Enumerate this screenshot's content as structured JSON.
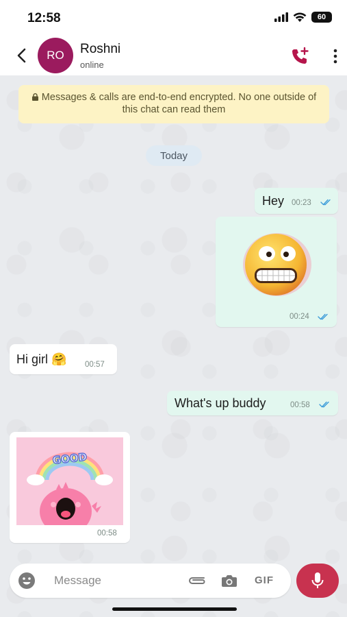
{
  "status_bar": {
    "time": "12:58",
    "battery": "60"
  },
  "header": {
    "avatar_initials": "RO",
    "contact_name": "Roshni",
    "contact_status": "online",
    "avatar_color": "#9b1b5e",
    "accent_color": "#b5154b"
  },
  "encryption_notice": "Messages & calls are end-to-end encrypted. No one outside of this chat can read them",
  "date_chip": "Today",
  "messages": [
    {
      "direction": "out",
      "type": "text",
      "text": "Hey",
      "time": "00:23",
      "status": "read"
    },
    {
      "direction": "out",
      "type": "sticker",
      "sticker": "grimacing-face-emoji",
      "time": "00:24",
      "status": "read"
    },
    {
      "direction": "in",
      "type": "text",
      "text": "Hi girl 🤗",
      "time": "00:57"
    },
    {
      "direction": "out",
      "type": "text",
      "text": "What's up buddy",
      "time": "00:58",
      "status": "read"
    },
    {
      "direction": "in",
      "type": "sticker",
      "sticker": "pink-dino-good-rainbow",
      "sticker_text": "GOOD",
      "time": "00:58"
    }
  ],
  "composer": {
    "placeholder": "Message",
    "gif_label": "GIF",
    "mic_color": "#c8324f"
  }
}
